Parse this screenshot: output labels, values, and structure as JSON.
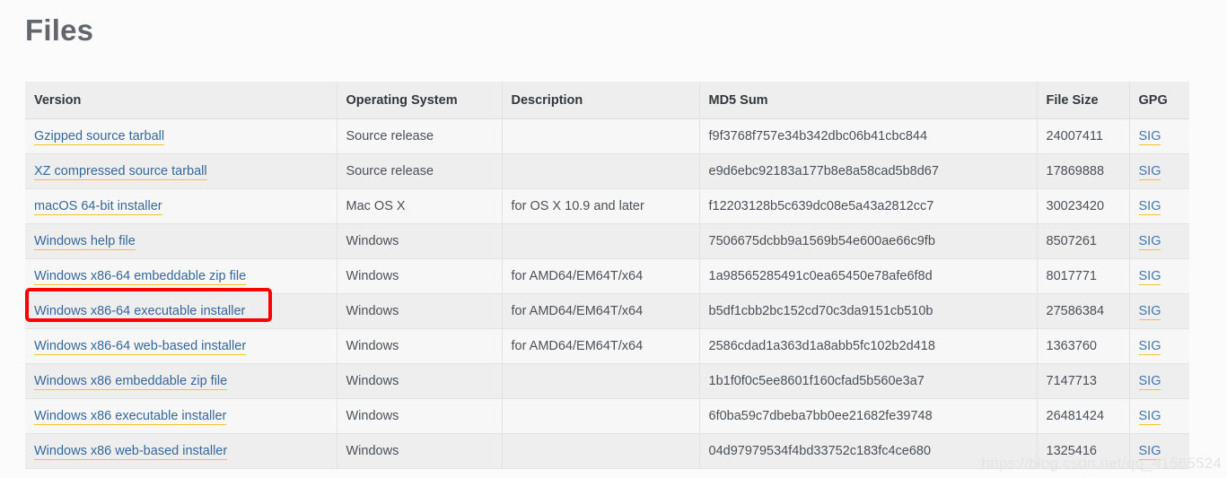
{
  "page": {
    "title": "Files",
    "watermark": "https://blog.csdn.net/qq_41565524"
  },
  "table": {
    "columns": [
      {
        "key": "version",
        "label": "Version"
      },
      {
        "key": "os",
        "label": "Operating System"
      },
      {
        "key": "description",
        "label": "Description"
      },
      {
        "key": "md5",
        "label": "MD5 Sum"
      },
      {
        "key": "size",
        "label": "File Size"
      },
      {
        "key": "gpg",
        "label": "GPG"
      }
    ],
    "gpg_link_label": "SIG",
    "rows": [
      {
        "version": "Gzipped source tarball",
        "os": "Source release",
        "description": "",
        "md5": "f9f3768f757e34b342dbc06b41cbc844",
        "size": "24007411",
        "gpg": "SIG",
        "highlighted": false
      },
      {
        "version": "XZ compressed source tarball",
        "os": "Source release",
        "description": "",
        "md5": "e9d6ebc92183a177b8e8a58cad5b8d67",
        "size": "17869888",
        "gpg": "SIG",
        "highlighted": false
      },
      {
        "version": "macOS 64-bit installer",
        "os": "Mac OS X",
        "description": "for OS X 10.9 and later",
        "md5": "f12203128b5c639dc08e5a43a2812cc7",
        "size": "30023420",
        "gpg": "SIG",
        "highlighted": false
      },
      {
        "version": "Windows help file",
        "os": "Windows",
        "description": "",
        "md5": "7506675dcbb9a1569b54e600ae66c9fb",
        "size": "8507261",
        "gpg": "SIG",
        "highlighted": false
      },
      {
        "version": "Windows x86-64 embeddable zip file",
        "os": "Windows",
        "description": "for AMD64/EM64T/x64",
        "md5": "1a98565285491c0ea65450e78afe6f8d",
        "size": "8017771",
        "gpg": "SIG",
        "highlighted": false
      },
      {
        "version": "Windows x86-64 executable installer",
        "os": "Windows",
        "description": "for AMD64/EM64T/x64",
        "md5": "b5df1cbb2bc152cd70c3da9151cb510b",
        "size": "27586384",
        "gpg": "SIG",
        "highlighted": true
      },
      {
        "version": "Windows x86-64 web-based installer",
        "os": "Windows",
        "description": "for AMD64/EM64T/x64",
        "md5": "2586cdad1a363d1a8abb5fc102b2d418",
        "size": "1363760",
        "gpg": "SIG",
        "highlighted": false
      },
      {
        "version": "Windows x86 embeddable zip file",
        "os": "Windows",
        "description": "",
        "md5": "1b1f0f0c5ee8601f160cfad5b560e3a7",
        "size": "7147713",
        "gpg": "SIG",
        "highlighted": false
      },
      {
        "version": "Windows x86 executable installer",
        "os": "Windows",
        "description": "",
        "md5": "6f0ba59c7dbeba7bb0ee21682fe39748",
        "size": "26481424",
        "gpg": "SIG",
        "highlighted": false
      },
      {
        "version": "Windows x86 web-based installer",
        "os": "Windows",
        "description": "",
        "md5": "04d97979534f4bd33752c183fc4ce680",
        "size": "1325416",
        "gpg": "SIG",
        "highlighted": false
      }
    ]
  },
  "colors": {
    "link": "#35689c",
    "link_underline": "#f2c230",
    "annotation": "#fe0000",
    "heading": "#63666b",
    "header_bg": "#eeeeee",
    "row_odd_bg": "#f7f7f7",
    "row_even_bg": "#eeeeee"
  }
}
